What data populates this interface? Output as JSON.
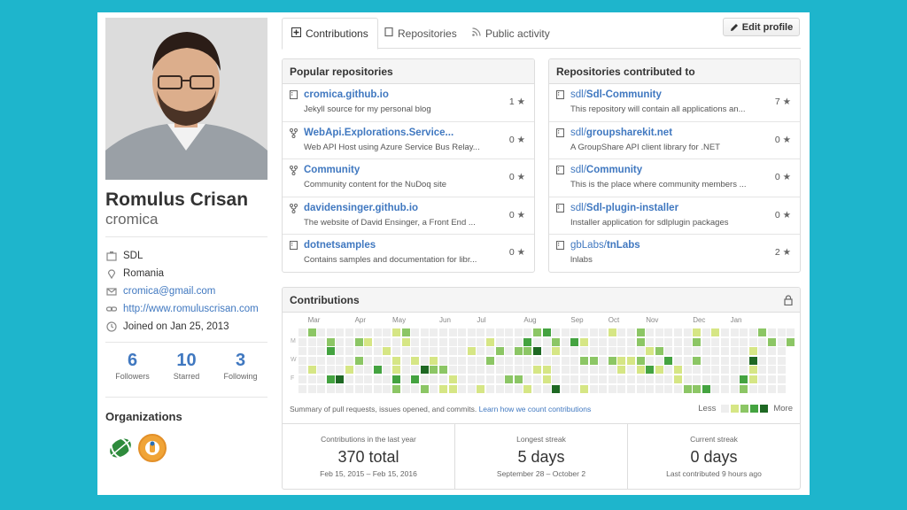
{
  "profile": {
    "name": "Romulus Crisan",
    "login": "cromica",
    "company": "SDL",
    "location": "Romania",
    "email": "cromica@gmail.com",
    "website": "http://www.romuluscrisan.com",
    "joined": "Joined on Jan 25, 2013"
  },
  "stats": [
    {
      "num": "6",
      "label": "Followers"
    },
    {
      "num": "10",
      "label": "Starred"
    },
    {
      "num": "3",
      "label": "Following"
    }
  ],
  "organizations_title": "Organizations",
  "tabs": [
    {
      "label": "Contributions",
      "active": true
    },
    {
      "label": "Repositories",
      "active": false
    },
    {
      "label": "Public activity",
      "active": false
    }
  ],
  "edit_profile": "Edit profile",
  "popular": {
    "title": "Popular repositories",
    "repos": [
      {
        "owner": "",
        "name": "cromica.github.io",
        "desc": "Jekyll source for my personal blog",
        "stars": "1",
        "icon": "repo-icon"
      },
      {
        "owner": "",
        "name": "WebApi.Explorations.Service...",
        "desc": "Web API Host using Azure Service Bus Relay...",
        "stars": "0",
        "icon": "fork-icon"
      },
      {
        "owner": "",
        "name": "Community",
        "desc": "Community content for the NuDoq site",
        "stars": "0",
        "icon": "fork-icon"
      },
      {
        "owner": "",
        "name": "davidensinger.github.io",
        "desc": "The website of David Ensinger, a Front End ...",
        "stars": "0",
        "icon": "fork-icon"
      },
      {
        "owner": "",
        "name": "dotnetsamples",
        "desc": "Contains samples and documentation for libr...",
        "stars": "0",
        "icon": "repo-icon"
      }
    ]
  },
  "contributed": {
    "title": "Repositories contributed to",
    "repos": [
      {
        "owner": "sdl/",
        "name": "Sdl-Community",
        "desc": "This repository will contain all applications an...",
        "stars": "7",
        "icon": "repo-icon"
      },
      {
        "owner": "sdl/",
        "name": "groupsharekit.net",
        "desc": "A GroupShare API client library for .NET",
        "stars": "0",
        "icon": "repo-icon"
      },
      {
        "owner": "sdl/",
        "name": "Community",
        "desc": "This is the place where community members ...",
        "stars": "0",
        "icon": "repo-icon"
      },
      {
        "owner": "sdl/",
        "name": "Sdl-plugin-installer",
        "desc": "Installer application for sdlplugin packages",
        "stars": "0",
        "icon": "repo-icon"
      },
      {
        "owner": "gbLabs/",
        "name": "tnLabs",
        "desc": "lnlabs",
        "stars": "2",
        "icon": "repo-icon"
      }
    ]
  },
  "contributions": {
    "title": "Contributions",
    "months": [
      "Mar",
      "Apr",
      "May",
      "Jun",
      "Jul",
      "Aug",
      "Sep",
      "Oct",
      "Nov",
      "Dec",
      "Jan"
    ],
    "day_labels": [
      "M",
      "W",
      "F"
    ],
    "summary_text": "Summary of pull requests, issues opened, and commits.",
    "summary_link": "Learn how we count contributions",
    "legend_less": "Less",
    "legend_more": "More",
    "colors": [
      "#eeeeee",
      "#d6e685",
      "#8cc665",
      "#44a340",
      "#1e6823"
    ],
    "totals": [
      {
        "label": "Contributions in the last year",
        "value": "370 total",
        "range": "Feb 15, 2015 – Feb 15, 2016"
      },
      {
        "label": "Longest streak",
        "value": "5 days",
        "range": "September 28 – October 2"
      },
      {
        "label": "Current streak",
        "value": "0 days",
        "range": "Last contributed 9 hours ago"
      }
    ]
  }
}
